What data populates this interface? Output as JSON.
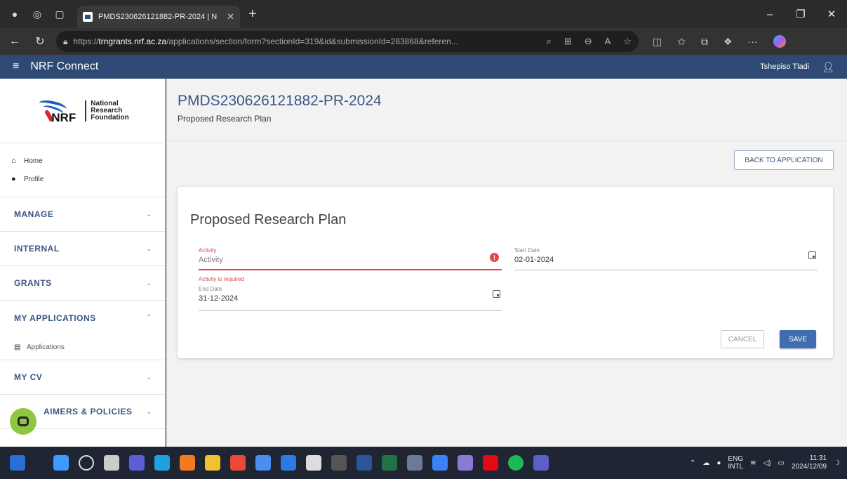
{
  "browser": {
    "tab_title": "PMDS230626121882-PR-2024 | N",
    "url_scheme": "https://",
    "url_host": "trngrants.nrf.ac.za",
    "url_path": "/applications/section/form?sectionId=319&id&submissionId=283868&referen..."
  },
  "app": {
    "title": "NRF Connect",
    "user_name": "Tshepiso Tladi"
  },
  "logo": {
    "mark": "NRF",
    "line1": "National",
    "line2": "Research",
    "line3": "Foundation"
  },
  "sidebar": {
    "links": [
      {
        "label": "Home",
        "icon": "home-icon"
      },
      {
        "label": "Profile",
        "icon": "person-icon"
      }
    ],
    "sections": [
      {
        "label": "MANAGE"
      },
      {
        "label": "INTERNAL"
      },
      {
        "label": "GRANTS"
      },
      {
        "label": "MY APPLICATIONS"
      },
      {
        "label": "MY CV"
      },
      {
        "label": "AIMERS & POLICIES"
      }
    ],
    "sub_items": [
      {
        "label": "Applications",
        "icon": "document-icon"
      }
    ]
  },
  "main": {
    "title": "PMDS230626121882-PR-2024",
    "subtitle": "Proposed Research Plan",
    "back_button": "BACK TO APPLICATION",
    "card": {
      "title": "Proposed Research Plan",
      "activity": {
        "label": "Activity",
        "placeholder": "Activity",
        "error": "Activity is required"
      },
      "start_date": {
        "label": "Start Date",
        "value": "02-01-2024"
      },
      "end_date": {
        "label": "End Date",
        "value": "31-12-2024"
      },
      "cancel_label": "CANCEL",
      "save_label": "SAVE"
    }
  },
  "taskbar": {
    "lang_line1": "ENG",
    "lang_line2": "INTL",
    "time": "11:31",
    "date": "2024/12/09"
  },
  "colors": {
    "app_header": "#2e4a74",
    "accent": "#3b5682",
    "error": "#e0484d",
    "save": "#3f6db0",
    "chat_fab": "#8dc63f"
  }
}
